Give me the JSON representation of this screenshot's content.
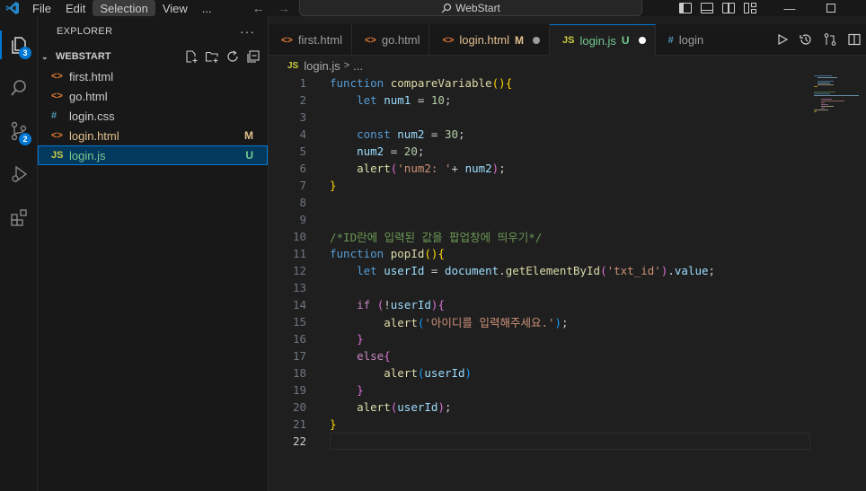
{
  "menu": [
    "File",
    "Edit",
    "Selection",
    "View",
    "..."
  ],
  "menu_active": "Selection",
  "command_center": "WebStart",
  "activity": {
    "explorer_badge": "3",
    "scm_badge": "2"
  },
  "sidebar": {
    "title": "EXPLORER",
    "section": "WEBSTART",
    "files": [
      {
        "name": "first.html",
        "icon": "<>",
        "color": "#e37933",
        "status": ""
      },
      {
        "name": "go.html",
        "icon": "<>",
        "color": "#e37933",
        "status": ""
      },
      {
        "name": "login.css",
        "icon": "#",
        "color": "#519aba",
        "status": ""
      },
      {
        "name": "login.html",
        "icon": "<>",
        "color": "#e37933",
        "status": "M",
        "status_color": "#e2c08d",
        "name_color": "#e2c08d"
      },
      {
        "name": "login.js",
        "icon": "JS",
        "color": "#cbcb41",
        "status": "U",
        "status_color": "#73c991",
        "name_color": "#73c991"
      }
    ]
  },
  "tabs": [
    {
      "label": "first.html",
      "icon": "<>",
      "color": "#e37933"
    },
    {
      "label": "go.html",
      "icon": "<>",
      "color": "#e37933"
    },
    {
      "label": "login.html",
      "icon": "<>",
      "color": "#e37933",
      "status": "M"
    },
    {
      "label": "login.js",
      "icon": "JS",
      "color": "#cbcb41",
      "status": "U"
    },
    {
      "label": "login",
      "icon": "#",
      "color": "#519aba"
    }
  ],
  "breadcrumb": {
    "file": "login.js",
    "rest": "..."
  },
  "code": {
    "lines": [
      "1",
      "2",
      "3",
      "4",
      "5",
      "6",
      "7",
      "8",
      "9",
      "10",
      "11",
      "12",
      "13",
      "14",
      "15",
      "16",
      "17",
      "18",
      "19",
      "20",
      "21",
      "22"
    ],
    "tokens": {
      "l1_kw": "function",
      "l1_fn": "compareVariable",
      "l1_p1": "()",
      "l1_b": "{",
      "l2_kw": "let",
      "l2_v": "num1",
      "l2_eq": " = ",
      "l2_n": "10",
      "l2_end": ";",
      "l4_kw": "const",
      "l4_v": "num2",
      "l4_eq": " = ",
      "l4_n": "30",
      "l4_end": ";",
      "l5_v": "num2",
      "l5_eq": " = ",
      "l5_n": "20",
      "l5_end": ";",
      "l6_fn": "alert",
      "l6_p": "(",
      "l6_s": "'num2: '",
      "l6_op": "+ ",
      "l6_v": "num2",
      "l6_pc": ")",
      "l6_end": ";",
      "l7_b": "}",
      "l10_c": "/*ID란에 입력된 값을 팝업창에 띄우기*/",
      "l11_kw": "function",
      "l11_fn": "popId",
      "l11_p": "()",
      "l11_b": "{",
      "l12_kw": "let",
      "l12_v": "userId",
      "l12_eq": " = ",
      "l12_o": "document",
      "l12_dot": ".",
      "l12_fn": "getElementById",
      "l12_p": "(",
      "l12_s": "'txt_id'",
      "l12_pc": ")",
      "l12_dot2": ".",
      "l12_prop": "value",
      "l12_end": ";",
      "l14_kw": "if",
      "l14_sp": " ",
      "l14_p": "(",
      "l14_not": "!",
      "l14_v": "userId",
      "l14_pc": ")",
      "l14_b": "{",
      "l15_fn": "alert",
      "l15_p": "(",
      "l15_s": "'아이디를 입력해주세요.'",
      "l15_pc": ")",
      "l15_end": ";",
      "l16_b": "}",
      "l17_kw": "else",
      "l17_b": "{",
      "l18_fn": "alert",
      "l18_p": "(",
      "l18_v": "userId",
      "l18_pc": ")",
      "l19_b": "}",
      "l20_fn": "alert",
      "l20_p": "(",
      "l20_v": "userId",
      "l20_pc": ")",
      "l20_end": ";",
      "l21_b": "}"
    }
  },
  "colors": {
    "accent": "#0078d4",
    "modified": "#e2c08d",
    "untracked": "#73c991"
  }
}
